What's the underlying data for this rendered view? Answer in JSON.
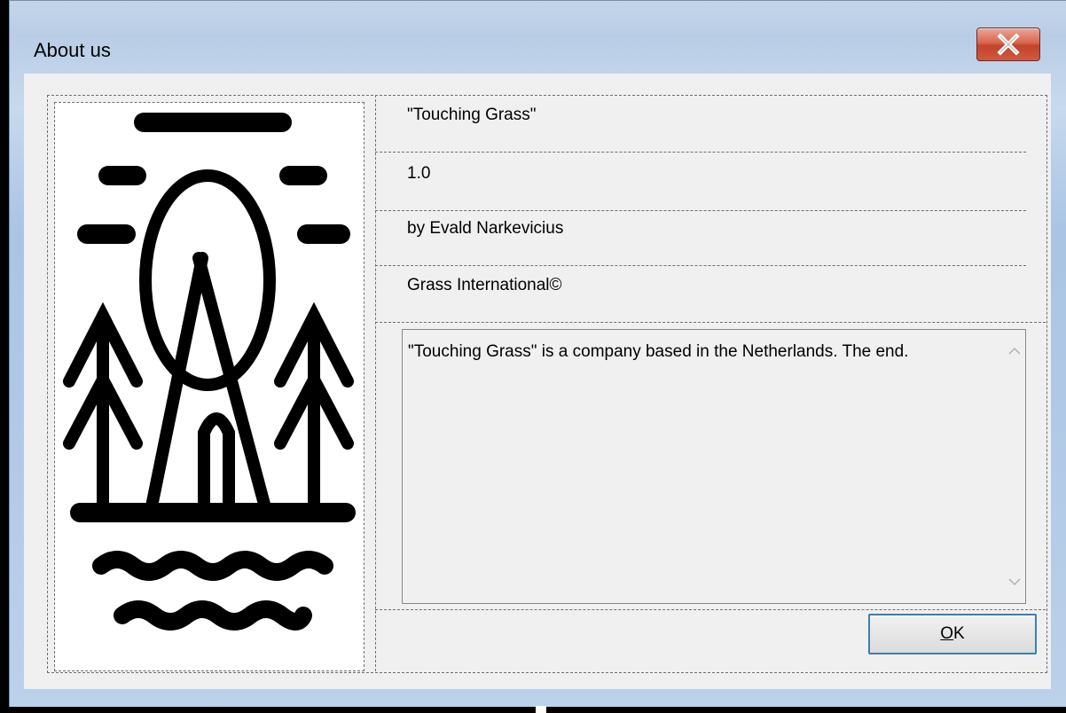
{
  "window": {
    "title": "About us",
    "close_icon": "close-icon"
  },
  "info": {
    "product_name": "\"Touching Grass\"",
    "version": "1.0",
    "author": "by Evald Narkevicius",
    "company": "Grass International©"
  },
  "description": {
    "text": "\"Touching Grass\" is a company based in the Netherlands. The end."
  },
  "buttons": {
    "ok_prefix": "O",
    "ok_rest": "K"
  },
  "icons": {
    "logo": "campsite-logo-icon",
    "scroll_up": "chevron-up-icon",
    "scroll_down": "chevron-down-icon"
  },
  "colors": {
    "close_button": "#c9462c",
    "ok_border": "#3c7fb1",
    "client_bg": "#f0f0f0"
  }
}
